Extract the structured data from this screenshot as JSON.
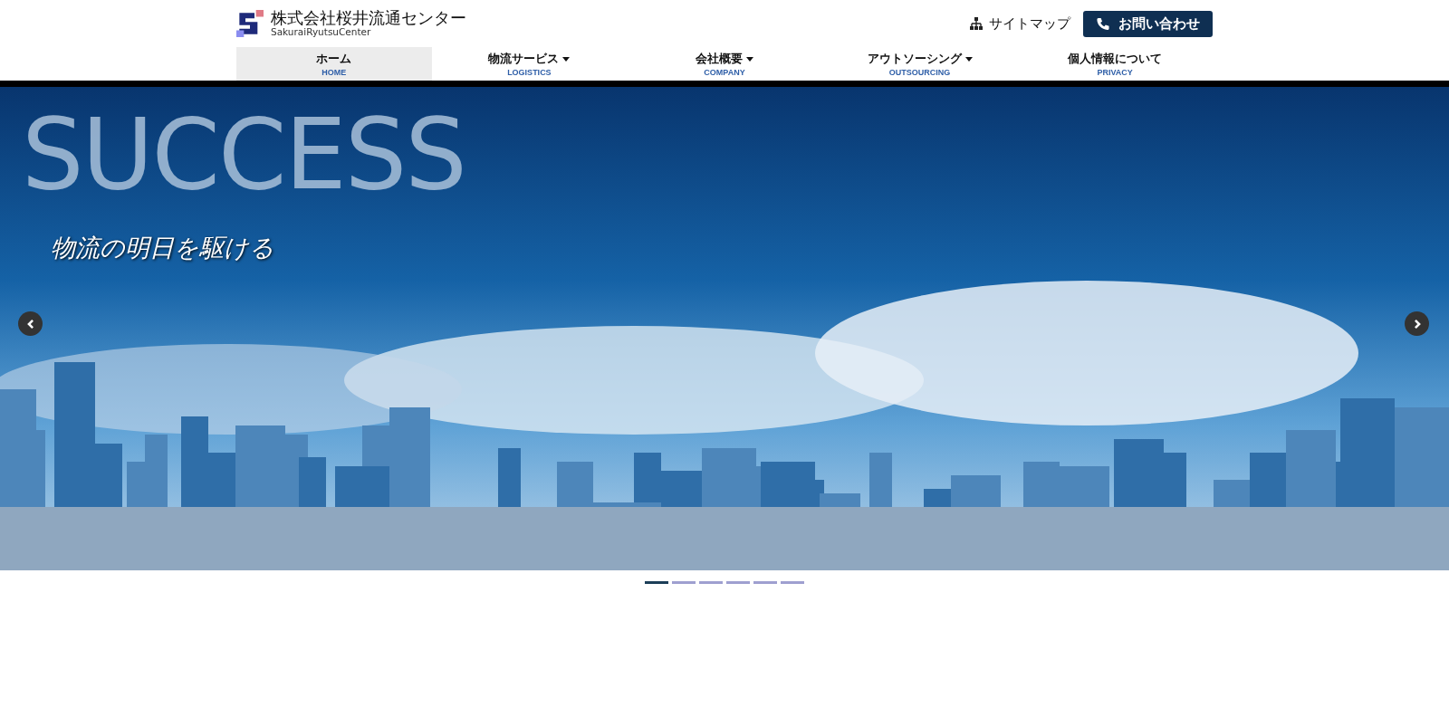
{
  "header": {
    "logo_title": "株式会社桜井流通センター",
    "logo_subtitle": "SakuraiRyutsuCenter",
    "sitemap_link": "サイトマップ",
    "contact_button": "お問い合わせ"
  },
  "nav": [
    {
      "label": "ホーム",
      "sublabel": "HOME",
      "dropdown": false,
      "selected": true
    },
    {
      "label": "物流サービス",
      "sublabel": "LOGISTICS",
      "dropdown": true,
      "selected": false
    },
    {
      "label": "会社概要",
      "sublabel": "COMPANY",
      "dropdown": true,
      "selected": false
    },
    {
      "label": "アウトソーシング",
      "sublabel": "OUTSOURCING",
      "dropdown": true,
      "selected": false
    },
    {
      "label": "個人情報について",
      "sublabel": "PRIVACY",
      "dropdown": false,
      "selected": false
    }
  ],
  "hero": {
    "headline": "SUCCESS",
    "tagline": "物流の明日を駆ける"
  },
  "slider_indicators": [
    {
      "selected": true
    },
    {
      "selected": false
    },
    {
      "selected": false
    },
    {
      "selected": false
    },
    {
      "selected": false
    },
    {
      "selected": false
    }
  ]
}
